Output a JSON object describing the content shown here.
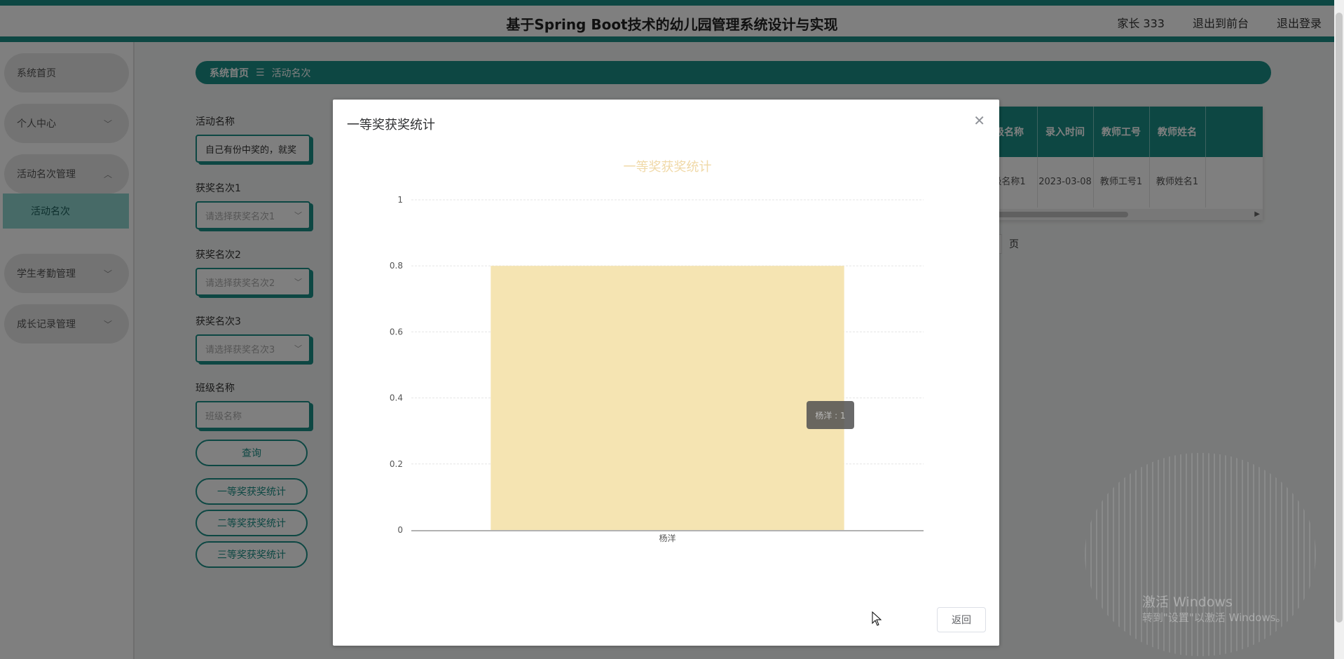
{
  "header": {
    "title": "基于Spring Boot技术的幼儿园管理系统设计与实现",
    "nav": [
      "家长 333",
      "退出到前台",
      "退出登录"
    ]
  },
  "sidebar": {
    "items": [
      {
        "label": "系统首页"
      },
      {
        "label": "个人中心"
      },
      {
        "label": "活动名次管理"
      },
      {
        "label": "学生考勤管理"
      },
      {
        "label": "成长记录管理"
      }
    ],
    "active_sub": "活动名次"
  },
  "breadcrumb": {
    "home": "系统首页",
    "separator": "☰",
    "current": "活动名次"
  },
  "search_form": {
    "activity_label": "活动名称",
    "activity_value": "自己有份中奖的，就奖",
    "award1_label": "获奖名次1",
    "award1_placeholder": "请选择获奖名次1",
    "award2_label": "获奖名次2",
    "award2_placeholder": "请选择获奖名次2",
    "award3_label": "获奖名次3",
    "award3_placeholder": "请选择获奖名次3",
    "class_label": "班级名称",
    "class_placeholder": "班级名称",
    "query_button": "查询",
    "stats_buttons": [
      "一等奖获奖统计",
      "二等奖获奖统计",
      "三等奖获奖统计"
    ]
  },
  "table": {
    "headers": [
      "级名称",
      "录入时间",
      "教师工号",
      "教师姓名"
    ],
    "rows": [
      [
        "级名称1",
        "2023-03-08",
        "教师工号1",
        "教师姓名1"
      ]
    ],
    "page_suffix": "页"
  },
  "dialog": {
    "title": "一等奖获奖统计",
    "return_button": "返回"
  },
  "chart_data": {
    "type": "bar",
    "title": "一等奖获奖统计",
    "categories": [
      "杨洋"
    ],
    "values": [
      0.8
    ],
    "ylim": [
      0,
      1
    ],
    "yticks": [
      0,
      0.2,
      0.4,
      0.6,
      0.8,
      1
    ],
    "ytick_labels": [
      "0",
      "0.2",
      "0.4",
      "0.6",
      "0.8",
      "1"
    ],
    "bar_color": "#f5e4b2",
    "title_color": "#f0d9a8",
    "grid": true,
    "tooltip_text": "杨洋 : 1"
  },
  "watermark": {
    "line1": "激活 Windows",
    "line2": "转到\"设置\"以激活 Windows。"
  },
  "colors": {
    "accent": "#1a8f86"
  }
}
